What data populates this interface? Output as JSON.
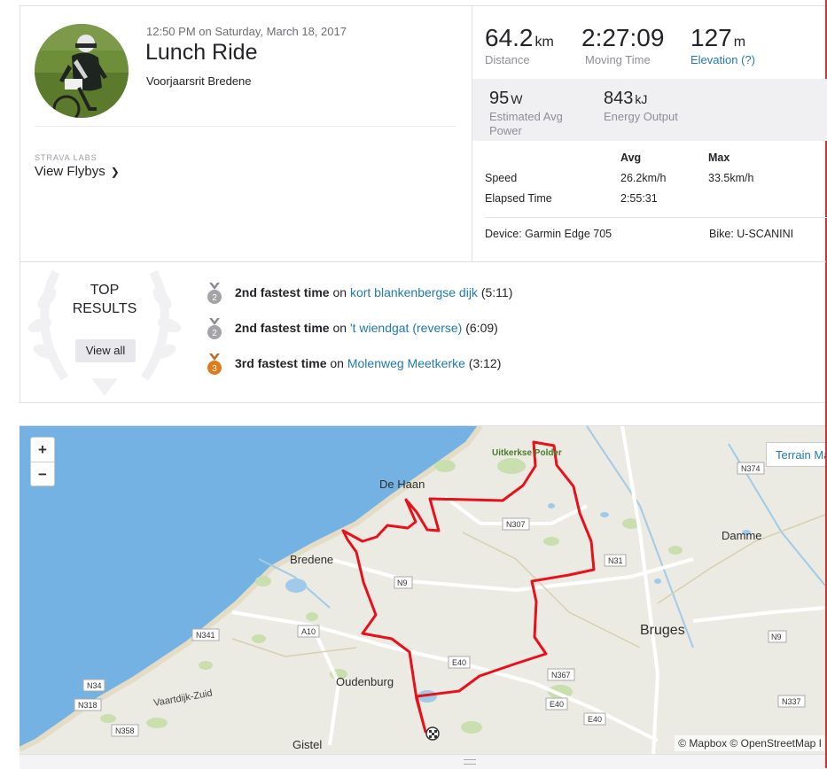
{
  "activity": {
    "timestamp": "12:50 PM on Saturday, March 18, 2017",
    "title": "Lunch Ride",
    "location": "Voorjaarsrit Bredene"
  },
  "labs": {
    "tag": "STRAVA LABS",
    "flyby_label": "View Flybys"
  },
  "stats": {
    "distance": {
      "value": "64.2",
      "unit": "km",
      "label": "Distance"
    },
    "moving_time": {
      "value": "2:27:09",
      "label": "Moving Time"
    },
    "elevation": {
      "value": "127",
      "unit": "m",
      "label": "Elevation (?)"
    },
    "power": {
      "value": "95",
      "unit": "W",
      "label_line1": "Estimated Avg",
      "label_line2": "Power"
    },
    "energy": {
      "value": "843",
      "unit": "kJ",
      "label": "Energy Output"
    }
  },
  "table": {
    "col_avg": "Avg",
    "col_max": "Max",
    "rows": [
      {
        "label": "Speed",
        "avg": "26.2km/h",
        "max": "33.5km/h"
      },
      {
        "label": "Elapsed Time",
        "avg": "2:55:31",
        "max": ""
      }
    ],
    "device": "Device: Garmin Edge 705",
    "bike": "Bike: U-SCANINI"
  },
  "top_results": {
    "title_line1": "TOP",
    "title_line2": "RESULTS",
    "view_all": "View all",
    "items": [
      {
        "rank_badge": "2",
        "rank_text": "2nd fastest time",
        "connector": " on ",
        "segment": "kort blankenbergse dijk",
        "time": " (5:11)",
        "medal_color": "#a4a4a8"
      },
      {
        "rank_badge": "2",
        "rank_text": "2nd fastest time",
        "connector": " on ",
        "segment": "'t wiendgat (reverse)",
        "time": " (6:09)",
        "medal_color": "#a4a4a8"
      },
      {
        "rank_badge": "3",
        "rank_text": "3rd fastest time",
        "connector": " on ",
        "segment": "Molenweg Meetkerke",
        "time": " (3:12)",
        "medal_color": "#e07b1c"
      }
    ]
  },
  "map": {
    "zoom_in": "+",
    "zoom_out": "−",
    "terrain_toggle": "Terrain Ma",
    "attribution": "© Mapbox © OpenStreetMap I",
    "places": {
      "de_haan": "De Haan",
      "bredene": "Bredene",
      "bruges": "Bruges",
      "damme": "Damme",
      "oudenburg": "Oudenburg",
      "gistel": "Gistel",
      "polder": "Uitkerkse Polder",
      "vaartdijk": "Vaartdijk-Zuid"
    },
    "roads": {
      "n374": "N374",
      "n307": "N307",
      "n31": "N31",
      "n9a": "N9",
      "n9b": "N9",
      "a10": "A10",
      "n341": "N341",
      "e40a": "E40",
      "e40b": "E40",
      "e40c": "E40",
      "n367": "N367",
      "n34": "N34",
      "n318": "N318",
      "n358": "N358",
      "n337": "N337"
    },
    "route_color": "#e8101a",
    "sea_color": "#73b2e2",
    "land_color": "#ecebe3"
  },
  "colors": {
    "link": "#1f79b2",
    "accent": "#fc4c02",
    "frame_line": "#d9302b"
  }
}
